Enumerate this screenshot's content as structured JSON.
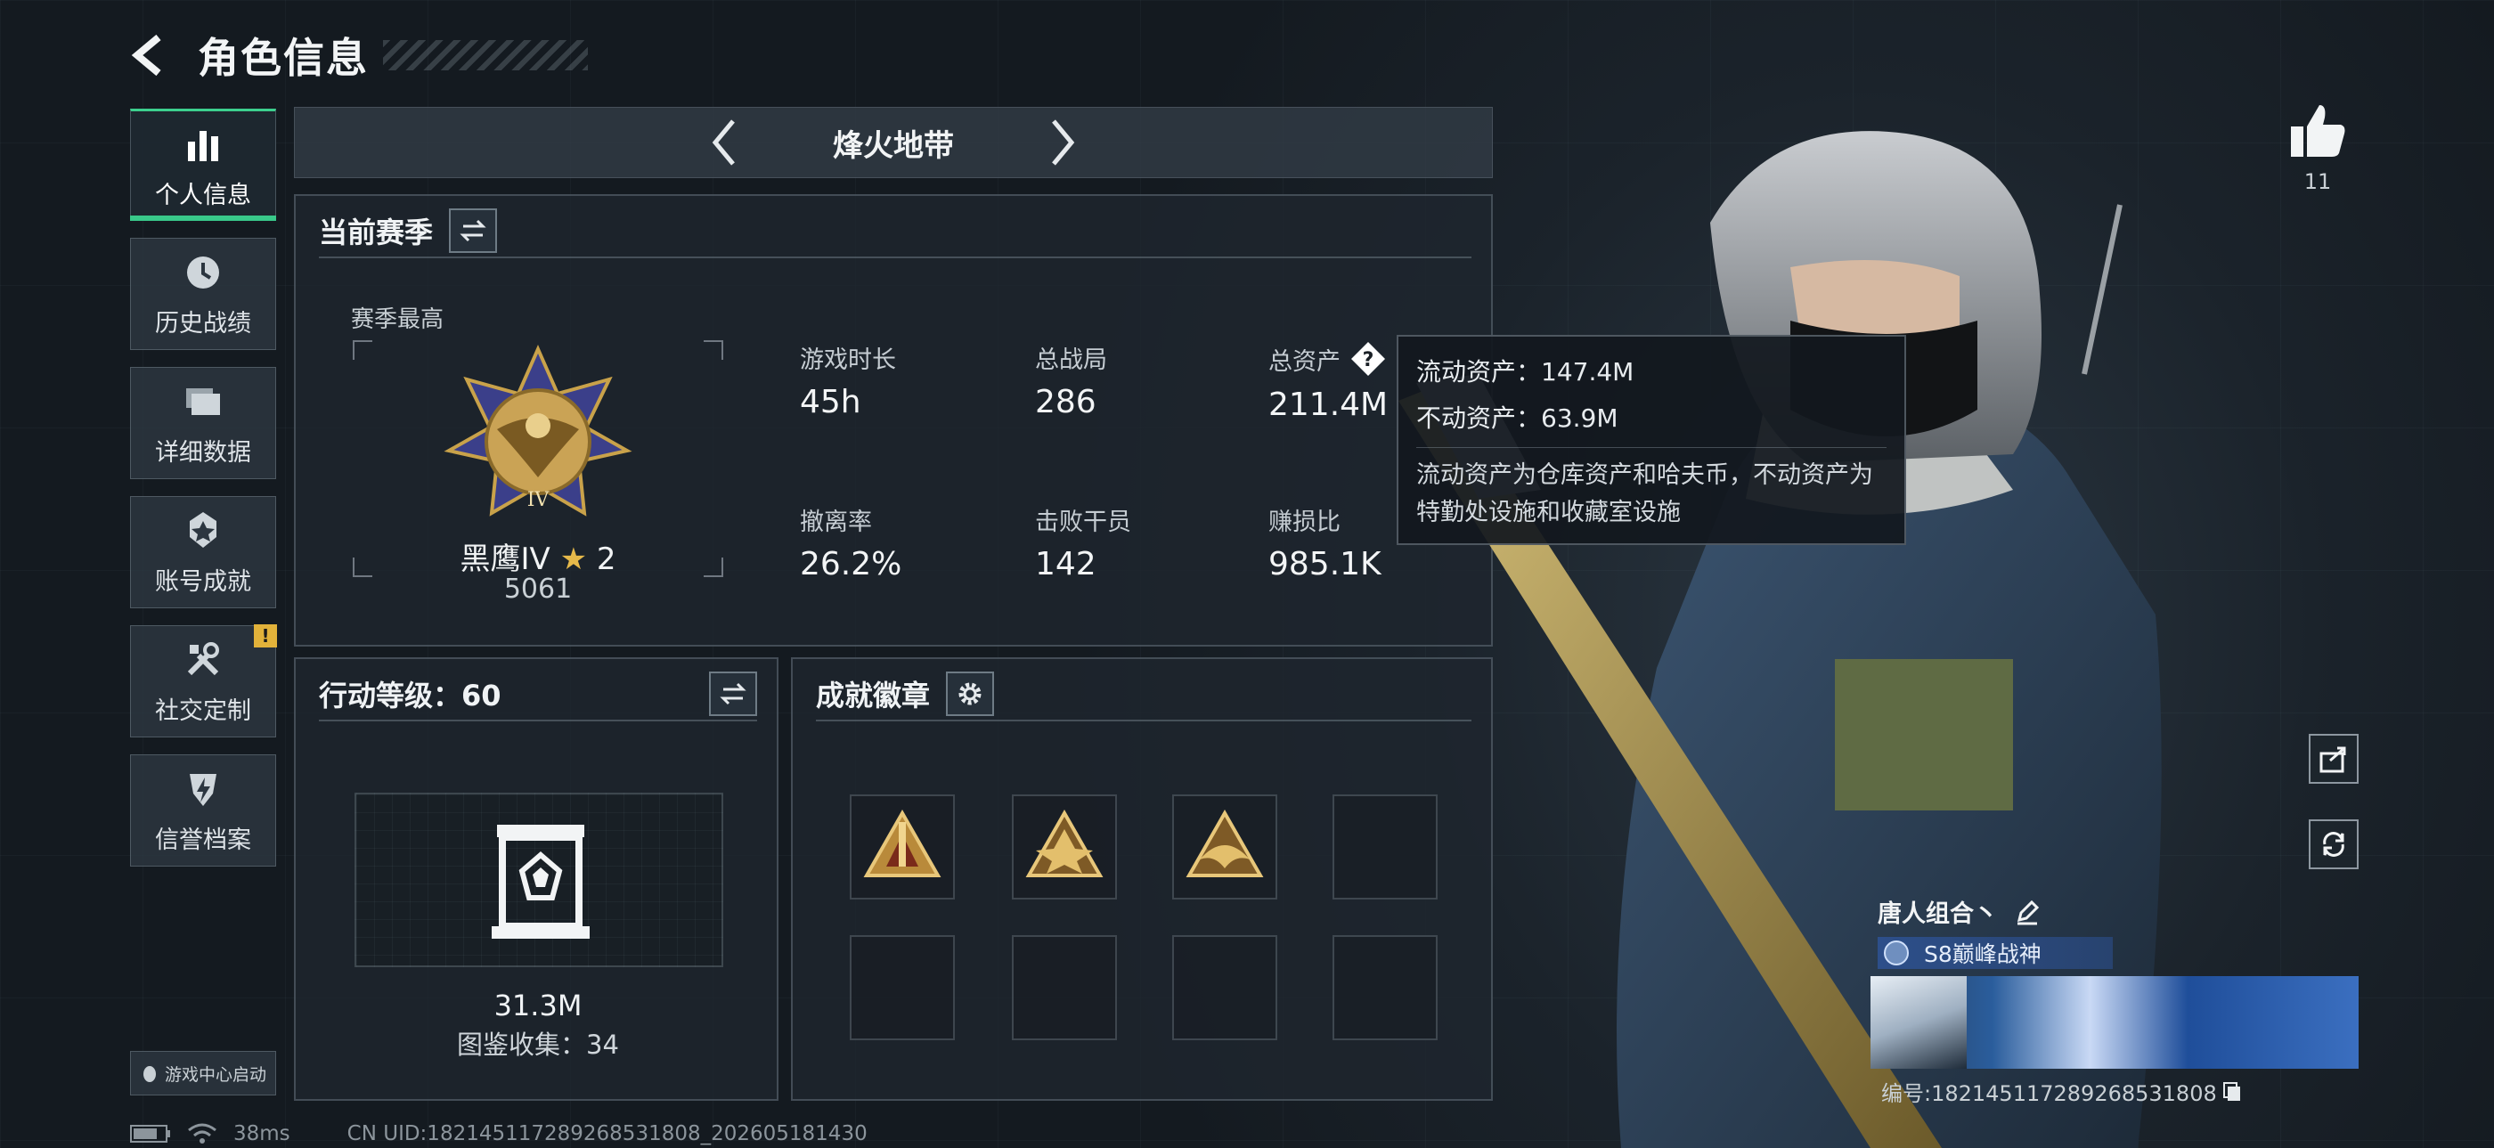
{
  "header": {
    "title": "角色信息",
    "back_icon": "back-arrow-icon"
  },
  "sidebar": {
    "items": [
      {
        "label": "个人信息",
        "icon": "bar-chart-icon",
        "active": true
      },
      {
        "label": "历史战绩",
        "icon": "history-clock-icon",
        "active": false
      },
      {
        "label": "详细数据",
        "icon": "folder-icon",
        "active": false
      },
      {
        "label": "账号成就",
        "icon": "medal-icon",
        "active": false
      },
      {
        "label": "社交定制",
        "icon": "tools-icon",
        "active": false,
        "badge": "!"
      },
      {
        "label": "信誉档案",
        "icon": "shield-bolt-icon",
        "active": false
      }
    ],
    "game_center": "游戏中心启动"
  },
  "mode_selector": {
    "label": "烽火地带"
  },
  "season": {
    "title": "当前赛季",
    "best_label": "赛季最高",
    "rank_name": "黑鹰IV",
    "rank_stars": "2",
    "rank_score": "5061",
    "stats": [
      {
        "label": "游戏时长",
        "value": "45h"
      },
      {
        "label": "总战局",
        "value": "286"
      },
      {
        "label": "总资产",
        "value": "211.4M"
      },
      {
        "label": "撤离率",
        "value": "26.2%"
      },
      {
        "label": "击败干员",
        "value": "142"
      },
      {
        "label": "赚损比",
        "value": "985.1K"
      }
    ]
  },
  "tooltip": {
    "line1": "流动资产：147.4M",
    "line2": "不动资产：63.9M",
    "desc": "流动资产为仓库资产和哈夫币，不动资产为特勤处设施和收藏室设施"
  },
  "action_level": {
    "title": "行动等级：60",
    "collection_value": "31.3M",
    "collection_count": "图鉴收集：34"
  },
  "badges": {
    "title": "成就徽章",
    "filled": 3,
    "total": 8
  },
  "right_panel": {
    "likes": "11",
    "team_name": "唐人组合丶",
    "title_badge": "S8巅峰战神",
    "serial": "编号:18214511728926853180​8"
  },
  "footer": {
    "ping": "38ms",
    "uid": "CN UID:18214511728926853180​8_202605181430"
  },
  "colors": {
    "accent_green": "#39c98a",
    "gold": "#e6b94a",
    "warning": "#e2b23a"
  }
}
